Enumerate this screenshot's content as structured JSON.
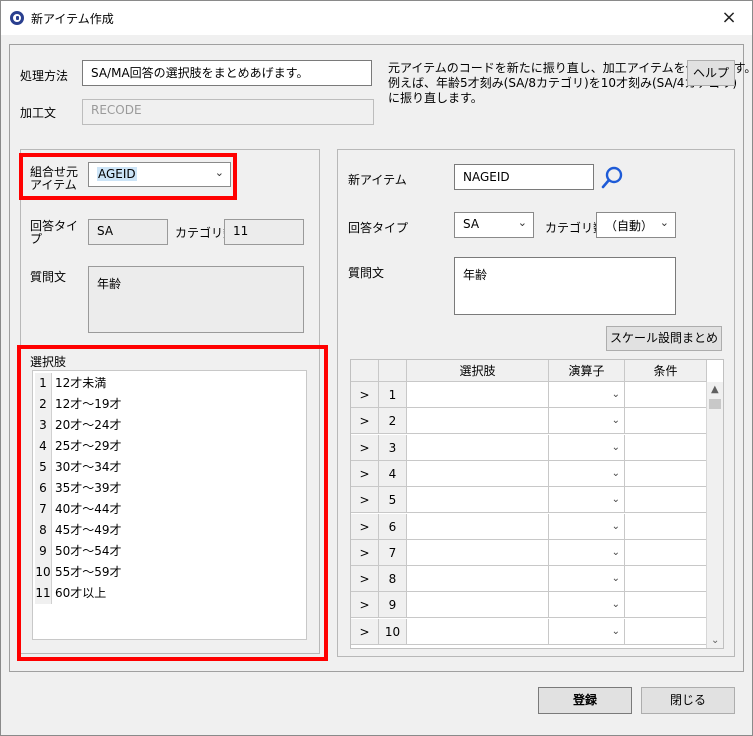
{
  "window": {
    "title": "新アイテム作成",
    "close": "×"
  },
  "header": {
    "method_label": "処理方法",
    "method_value": "SA/MA回答の選択肢をまとめあげます。",
    "processing_label": "加工文",
    "processing_value": "RECODE",
    "description_line1": "元アイテムのコードを新たに振り直し、加工アイテムを作成します。",
    "description_line2": "例えば、年齢5才刻み(SA/8カテゴリ)を10才刻み(SA/4カテゴリ)",
    "description_line3": "に振り直します。",
    "help_button": "ヘルプ"
  },
  "source": {
    "combo_label_line1": "組合せ元",
    "combo_label_line2": "アイテム",
    "combo_value": "AGEID",
    "answer_type_label_line1": "回答タイ",
    "answer_type_label_line2": "プ",
    "answer_type_value": "SA",
    "category_count_label": "カテゴリ数",
    "category_count_value": "11",
    "question_label": "質問文",
    "question_value": "年齢",
    "choices_label": "選択肢",
    "choices": [
      {
        "num": "1",
        "text": "12才未満"
      },
      {
        "num": "2",
        "text": "12才～19才"
      },
      {
        "num": "3",
        "text": "20才～24才"
      },
      {
        "num": "4",
        "text": "25才～29才"
      },
      {
        "num": "5",
        "text": "30才～34才"
      },
      {
        "num": "6",
        "text": "35才～39才"
      },
      {
        "num": "7",
        "text": "40才～44才"
      },
      {
        "num": "8",
        "text": "45才～49才"
      },
      {
        "num": "9",
        "text": "50才～54才"
      },
      {
        "num": "10",
        "text": "55才～59才"
      },
      {
        "num": "11",
        "text": "60才以上"
      }
    ]
  },
  "target": {
    "new_item_label": "新アイテム",
    "new_item_value": "NAGEID",
    "answer_type_label": "回答タイプ",
    "answer_type_value": "SA",
    "category_count_label": "カテゴリ数",
    "category_count_value": "（自動）",
    "question_label": "質問文",
    "question_value": "年齢",
    "scale_button": "スケール設問まとめ",
    "grid_headers": {
      "choice": "選択肢",
      "operator": "演算子",
      "condition": "条件"
    },
    "grid_rows": [
      {
        "arrow": ">",
        "num": "1"
      },
      {
        "arrow": ">",
        "num": "2"
      },
      {
        "arrow": ">",
        "num": "3"
      },
      {
        "arrow": ">",
        "num": "4"
      },
      {
        "arrow": ">",
        "num": "5"
      },
      {
        "arrow": ">",
        "num": "6"
      },
      {
        "arrow": ">",
        "num": "7"
      },
      {
        "arrow": ">",
        "num": "8"
      },
      {
        "arrow": ">",
        "num": "9"
      },
      {
        "arrow": ">",
        "num": "10"
      }
    ]
  },
  "footer": {
    "register_button": "登録",
    "close_button": "閉じる"
  },
  "colors": {
    "highlight_border": "#ff0000",
    "selection": "#cce4f7",
    "search_icon": "#1e5bd7"
  }
}
